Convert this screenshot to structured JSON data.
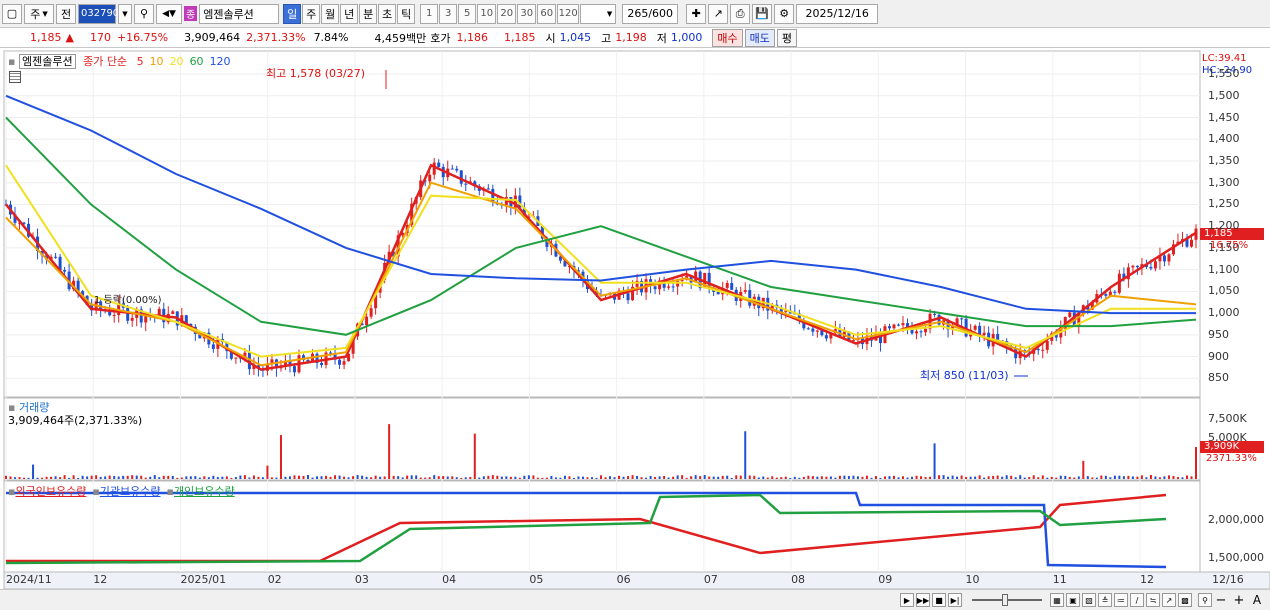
{
  "toolbar": {
    "period_select": "주",
    "prev_label": "전",
    "stock_code": "032790",
    "stock_badge": "종",
    "stock_name": "엠젠솔루션",
    "periods": [
      "일",
      "주",
      "월",
      "년",
      "분",
      "초",
      "틱"
    ],
    "active_period": "일",
    "intervals": [
      "1",
      "3",
      "5",
      "10",
      "20",
      "30",
      "60",
      "120"
    ],
    "count": "265",
    "count_total": "/600",
    "date": "2025/12/16"
  },
  "quote": {
    "price": "1,185",
    "change": "170",
    "change_pct": "+16.75%",
    "volume": "3,909,464",
    "volume_ratio": "2,371.33%",
    "turnover": "7.84%",
    "amount": "4,459백만",
    "ask_label": "호가",
    "ask": "1,186",
    "bid": "1,185",
    "open_label": "시",
    "open": "1,045",
    "high_label": "고",
    "high": "1,198",
    "low_label": "저",
    "low": "1,000",
    "buy_label": "매수",
    "sell_label": "매도",
    "eval_label": "평"
  },
  "price_panel": {
    "legend_name": "엠젠솔루션",
    "legend_type": "종가 단순",
    "ma_labels": [
      "5",
      "10",
      "20",
      "60",
      "120"
    ],
    "ma_colors": [
      "#e02020",
      "#f0a000",
      "#f0e020",
      "#20a040",
      "#2050e0"
    ],
    "lc_label": "LC:39.41",
    "hc_label": "HC:-24.90",
    "max_label": "최고 1,578 (03/27)",
    "min_label": "최저 850 (11/03)",
    "note_label": "1 등락(0.00%)",
    "current_price_tag": "1,185",
    "current_pct_tag": "16.75%",
    "y_ticks": [
      "1,550",
      "1,500",
      "1,450",
      "1,400",
      "1,350",
      "1,300",
      "1,250",
      "1,200",
      "1,150",
      "1,100",
      "1,050",
      "1,000",
      "950",
      "900",
      "850"
    ]
  },
  "volume_panel": {
    "title": "거래량",
    "value_label": "3,909,464주(2,371.33%)",
    "y_ticks": [
      "7,500K",
      "5,000K"
    ],
    "current_tag": "3,909K",
    "current_pct_tag": "2371.33%"
  },
  "holding_panel": {
    "legend": [
      "외국인보유수량",
      "기관보유수량",
      "개인보유수량"
    ],
    "legend_colors": [
      "#e02020",
      "#2050e0",
      "#20a040"
    ],
    "y_ticks": [
      "2,000,000",
      "1,500,000"
    ]
  },
  "x_axis": [
    "2024/11",
    "12",
    "2025/01",
    "02",
    "03",
    "04",
    "05",
    "06",
    "07",
    "08",
    "09",
    "10",
    "11",
    "12",
    "12/16"
  ],
  "chart_data": {
    "type": "line",
    "title": "",
    "x": [
      "2024/11",
      "2024/12",
      "2025/01",
      "2025/02",
      "2025/03",
      "2025/04",
      "2025/05",
      "2025/06",
      "2025/07",
      "2025/08",
      "2025/09",
      "2025/10",
      "2025/11",
      "2025/12",
      "2025/12/16"
    ],
    "ylim": [
      830,
      1580
    ],
    "series": [
      {
        "name": "5",
        "values": [
          1250,
          1010,
          990,
          870,
          900,
          1340,
          1250,
          1030,
          1090,
          1010,
          930,
          990,
          900,
          1060,
          1185
        ]
      },
      {
        "name": "10",
        "values": [
          1220,
          1020,
          980,
          880,
          910,
          1300,
          1240,
          1040,
          1080,
          1010,
          940,
          980,
          910,
          1040,
          1020
        ]
      },
      {
        "name": "20",
        "values": [
          1340,
          1040,
          980,
          900,
          920,
          1270,
          1260,
          1070,
          1070,
          1020,
          950,
          970,
          920,
          1010,
          1010
        ]
      },
      {
        "name": "60",
        "values": [
          1450,
          1250,
          1100,
          980,
          950,
          1030,
          1150,
          1200,
          1130,
          1060,
          1030,
          1000,
          970,
          970,
          985
        ]
      },
      {
        "name": "120",
        "values": [
          1500,
          1420,
          1320,
          1240,
          1150,
          1090,
          1080,
          1075,
          1100,
          1120,
          1100,
          1060,
          1010,
          1000,
          1000
        ]
      }
    ]
  },
  "bottombar": {
    "zoom_labels": [
      "−",
      "+",
      "A"
    ]
  }
}
